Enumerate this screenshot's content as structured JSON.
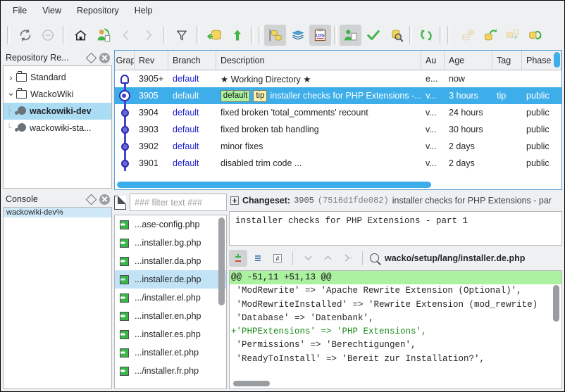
{
  "menu": {
    "items": [
      {
        "label": "File"
      },
      {
        "label": "View"
      },
      {
        "label": "Repository"
      },
      {
        "label": "Help"
      }
    ]
  },
  "toolbar": {
    "buttons": [
      {
        "name": "refresh-icon",
        "title": "Refresh"
      },
      {
        "name": "stop-icon",
        "title": "Stop"
      },
      {
        "name": "home-icon",
        "title": "Home"
      },
      {
        "name": "goto-revision-icon",
        "title": "Go to"
      },
      {
        "name": "back-arrow-icon",
        "title": "Back"
      },
      {
        "name": "forward-arrow-icon",
        "title": "Forward"
      },
      {
        "name": "filter-icon",
        "title": "Filter"
      },
      {
        "name": "incoming-icon",
        "title": "Incoming"
      },
      {
        "name": "pull-icon",
        "title": "Pull"
      },
      {
        "name": "graph-repo-icon",
        "title": "Repository graph"
      },
      {
        "name": "stack-icon",
        "title": "Shelve"
      },
      {
        "name": "log-icon",
        "title": "Log"
      },
      {
        "name": "commit-icon",
        "title": "Commit"
      },
      {
        "name": "check-icon",
        "title": "Verify"
      },
      {
        "name": "search-repo-icon",
        "title": "Search"
      },
      {
        "name": "sync-icon",
        "title": "Synchronize"
      },
      {
        "name": "outgoing-icon",
        "title": "Outgoing"
      },
      {
        "name": "push-icon",
        "title": "Push"
      },
      {
        "name": "bundle-icon",
        "title": "Bundle"
      },
      {
        "name": "export-icon",
        "title": "Export"
      }
    ]
  },
  "repository_panel": {
    "title": "Repository Re...",
    "tree": [
      {
        "label": "Standard",
        "type": "folder",
        "expanded": false,
        "depth": 0,
        "selected": false
      },
      {
        "label": "WackoWiki",
        "type": "folder",
        "expanded": true,
        "depth": 0,
        "selected": false
      },
      {
        "label": "wackowiki-dev",
        "type": "repo",
        "depth": 1,
        "selected": true
      },
      {
        "label": "wackowiki-sta...",
        "type": "repo",
        "depth": 1,
        "selected": false
      }
    ]
  },
  "console_panel": {
    "title": "Console",
    "lines": [
      "wackowiki-dev%"
    ]
  },
  "revision_table": {
    "columns": [
      {
        "label": "Grap",
        "key": "graph"
      },
      {
        "label": "Rev",
        "key": "rev"
      },
      {
        "label": "Branch",
        "key": "branch"
      },
      {
        "label": "Description",
        "key": "desc"
      },
      {
        "label": "Au",
        "key": "author"
      },
      {
        "label": "Age",
        "key": "age"
      },
      {
        "label": "Tag",
        "key": "tag"
      },
      {
        "label": "Phase",
        "key": "phase"
      }
    ],
    "rows": [
      {
        "rev": "3905+",
        "branch": "default",
        "desc": "★ Working Directory ★",
        "badges": [],
        "author": "e...",
        "age": "now",
        "tag": "",
        "phase": "",
        "selected": false,
        "node": "wd"
      },
      {
        "rev": "3905",
        "branch": "default",
        "desc": "installer checks for PHP Extensions -...",
        "badges": [
          "default",
          "tip"
        ],
        "author": "v...",
        "age": "3 hours",
        "tag": "tip",
        "phase": "public",
        "selected": true,
        "node": "cur"
      },
      {
        "rev": "3904",
        "branch": "default",
        "desc": "fixed broken 'total_comments' recount",
        "badges": [],
        "author": "v...",
        "age": "24 hours",
        "tag": "",
        "phase": "public",
        "selected": false,
        "node": "dot"
      },
      {
        "rev": "3903",
        "branch": "default",
        "desc": "fixed broken tab handling",
        "badges": [],
        "author": "v...",
        "age": "30 hours",
        "tag": "",
        "phase": "public",
        "selected": false,
        "node": "dot"
      },
      {
        "rev": "3902",
        "branch": "default",
        "desc": "minor fixes",
        "badges": [],
        "author": "v...",
        "age": "2 days",
        "tag": "",
        "phase": "public",
        "selected": false,
        "node": "dot"
      },
      {
        "rev": "3901",
        "branch": "default",
        "desc": "disabled trim code ...",
        "badges": [],
        "author": "v...",
        "age": "2 days",
        "tag": "",
        "phase": "public",
        "selected": false,
        "node": "dot"
      }
    ]
  },
  "file_panel": {
    "filter_placeholder": "### filter text ###",
    "filter_value": "",
    "files": [
      {
        "label": "...ase-config.php",
        "selected": false
      },
      {
        "label": "...installer.bg.php",
        "selected": false
      },
      {
        "label": "...installer.da.php",
        "selected": false
      },
      {
        "label": "...installer.de.php",
        "selected": true
      },
      {
        "label": ".../installer.el.php",
        "selected": false
      },
      {
        "label": "...installer.en.php",
        "selected": false
      },
      {
        "label": "...installer.es.php",
        "selected": false
      },
      {
        "label": "...installer.et.php",
        "selected": false
      },
      {
        "label": ".../installer.fr.php",
        "selected": false
      }
    ]
  },
  "changeset": {
    "label": "Changeset:",
    "rev": "3905",
    "hash": "(7516d1fde082)",
    "summary": "installer checks for PHP Extensions - par",
    "commit_message": "installer checks for PHP Extensions - part 1",
    "file_path": "wacko/setup/lang/installer.de.php",
    "tools": [
      {
        "name": "diff-mode-icon",
        "active": true
      },
      {
        "name": "annotate-icon",
        "active": false
      },
      {
        "name": "line-numbers-icon",
        "active": false
      },
      {
        "name": "next-diff-icon",
        "active": false
      },
      {
        "name": "prev-diff-icon",
        "active": false
      },
      {
        "name": "goto-diff-icon",
        "active": false
      }
    ]
  },
  "diff": {
    "lines": [
      {
        "type": "hunk",
        "text": "@@ -51,11 +51,13 @@"
      },
      {
        "type": "ctx",
        "text": " 'ModRewrite' => 'Apache Rewrite Extension (Optional)',"
      },
      {
        "type": "ctx",
        "text": " 'ModRewriteInstalled' => 'Rewrite Extension (mod_rewrite)"
      },
      {
        "type": "ctx",
        "text": " 'Database' => 'Datenbank',"
      },
      {
        "type": "add",
        "text": "+'PHPExtensions' => 'PHP Extensions',"
      },
      {
        "type": "ctx",
        "text": " 'Permissions' => 'Berechtigungen',"
      },
      {
        "type": "ctx",
        "text": " 'ReadyToInstall' => 'Bereit zur Installation?',"
      }
    ]
  },
  "colors": {
    "selection": "#3daee9",
    "tree_selection": "#aadcf4",
    "branch_link": "#2222cc",
    "badge_default": "#aaf2a0",
    "badge_tip": "#fcf3b0",
    "diff_add": "#1a8a1a",
    "hunk_bg": "#aaf2a0",
    "window_bg": "#eff0f1"
  }
}
